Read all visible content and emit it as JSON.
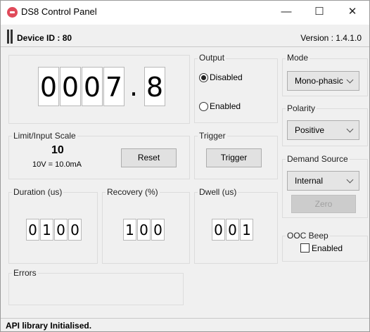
{
  "window": {
    "title": "DS8 Control Panel",
    "minimize": "—",
    "maximize": "☐",
    "close": "✕"
  },
  "header": {
    "device_id": "Device ID : 80",
    "version": "Version : 1.4.1.0"
  },
  "display": {
    "digits": [
      "0",
      "0",
      "0",
      "7"
    ],
    "separator": ".",
    "decimal": "8"
  },
  "output": {
    "label": "Output",
    "options": [
      {
        "label": "Disabled",
        "selected": true
      },
      {
        "label": "Enabled",
        "selected": false
      }
    ]
  },
  "mode": {
    "label": "Mode",
    "value": "Mono-phasic"
  },
  "polarity": {
    "label": "Polarity",
    "value": "Positive"
  },
  "demand_source": {
    "label": "Demand Source",
    "value": "Internal",
    "zero_button": "Zero"
  },
  "limit": {
    "label": "Limit/Input Scale",
    "value": "10",
    "scale": "10V = 10.0mA",
    "reset_button": "Reset"
  },
  "trigger": {
    "label": "Trigger",
    "button": "Trigger"
  },
  "duration": {
    "label": "Duration (us)",
    "digits": [
      "0",
      "1",
      "0",
      "0"
    ]
  },
  "recovery": {
    "label": "Recovery (%)",
    "digits": [
      "1",
      "0",
      "0"
    ]
  },
  "dwell": {
    "label": "Dwell (us)",
    "digits": [
      "0",
      "0",
      "1"
    ]
  },
  "ooc_beep": {
    "label": "OOC Beep",
    "checkbox_label": "Enabled",
    "checked": false
  },
  "errors": {
    "label": "Errors"
  },
  "status_bar": {
    "text": "API library Initialised."
  }
}
